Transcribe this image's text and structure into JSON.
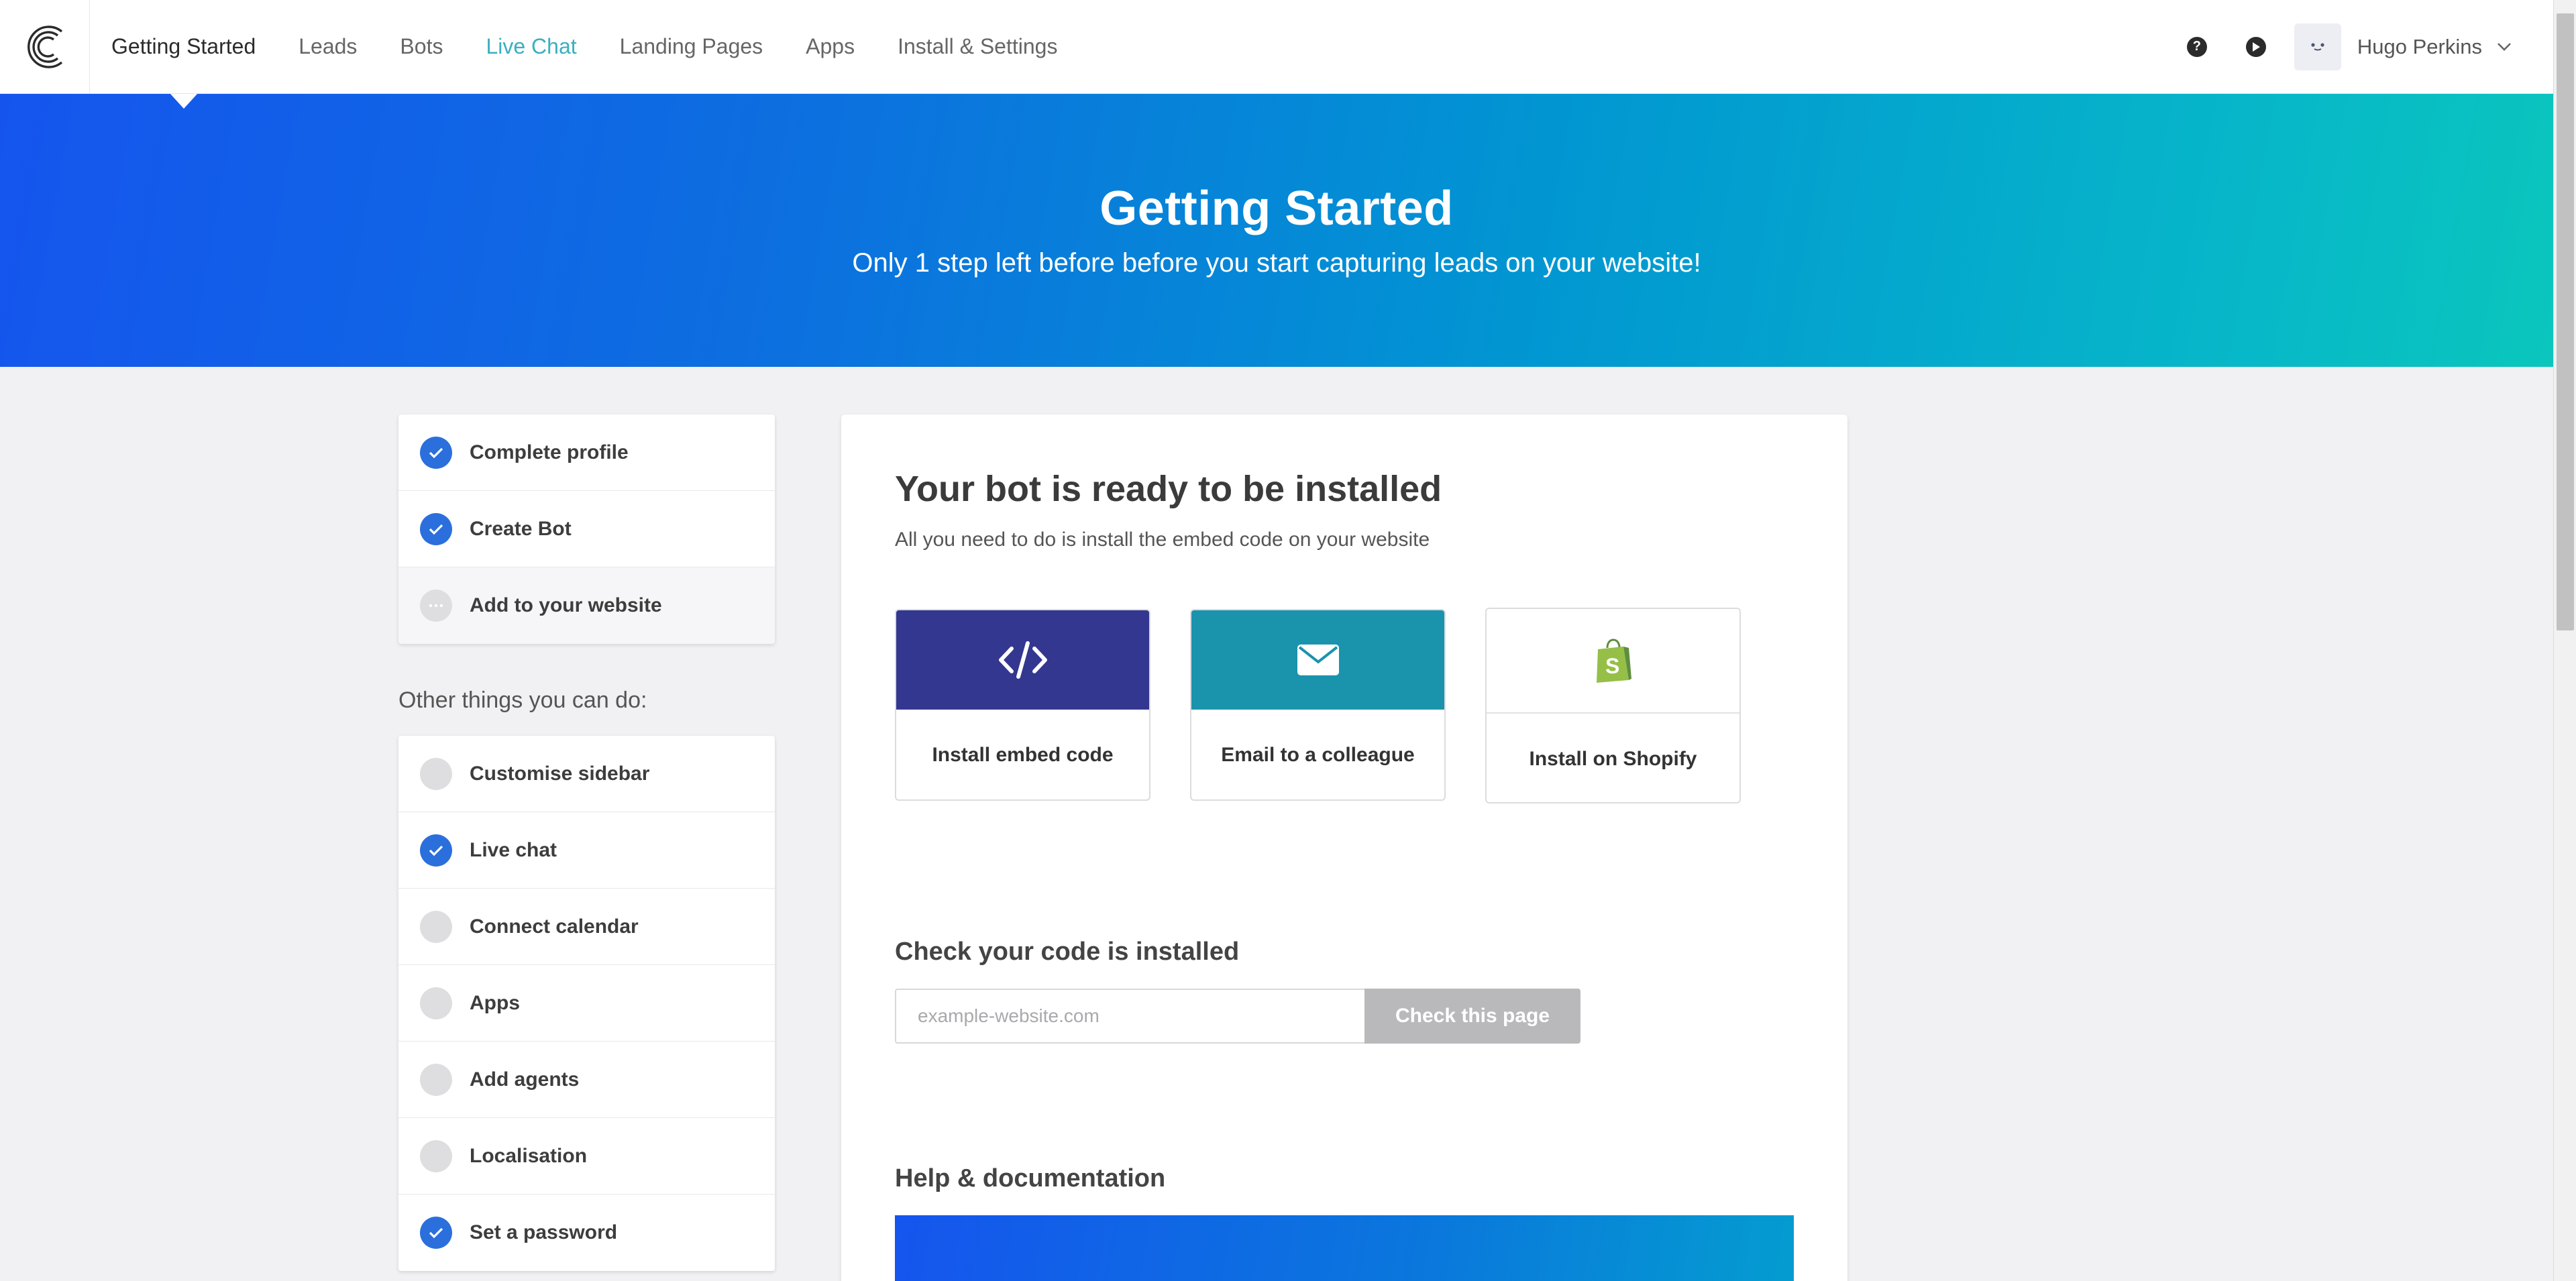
{
  "nav": {
    "items": [
      {
        "label": "Getting Started",
        "state": "active"
      },
      {
        "label": "Leads",
        "state": "normal"
      },
      {
        "label": "Bots",
        "state": "normal"
      },
      {
        "label": "Live Chat",
        "state": "highlight"
      },
      {
        "label": "Landing Pages",
        "state": "normal"
      },
      {
        "label": "Apps",
        "state": "normal"
      },
      {
        "label": "Install & Settings",
        "state": "normal"
      }
    ],
    "help_icon": "question-circle-icon",
    "video_icon": "play-circle-icon",
    "user_name": "Hugo Perkins"
  },
  "hero": {
    "title": "Getting Started",
    "subtitle": "Only 1 step left before before you start capturing leads on your website!"
  },
  "steps": [
    {
      "label": "Complete profile",
      "status": "done"
    },
    {
      "label": "Create Bot",
      "status": "done"
    },
    {
      "label": "Add to your website",
      "status": "pending"
    }
  ],
  "other": {
    "heading": "Other things you can do:",
    "items": [
      {
        "label": "Customise sidebar",
        "status": "todo"
      },
      {
        "label": "Live chat",
        "status": "done"
      },
      {
        "label": "Connect calendar",
        "status": "todo"
      },
      {
        "label": "Apps",
        "status": "todo"
      },
      {
        "label": "Add agents",
        "status": "todo"
      },
      {
        "label": "Localisation",
        "status": "todo"
      },
      {
        "label": "Set a password",
        "status": "done"
      }
    ]
  },
  "main": {
    "title": "Your bot is ready to be installed",
    "subtitle": "All you need to do is install the embed code on your website",
    "options": [
      {
        "label": "Install embed code",
        "icon": "code-icon",
        "color": "#33378f"
      },
      {
        "label": "Email to a colleague",
        "icon": "envelope-icon",
        "color": "#1a93ad"
      },
      {
        "label": "Install on Shopify",
        "icon": "shopify-bag-icon",
        "color": "#95bf47"
      }
    ],
    "check": {
      "title": "Check your code is installed",
      "placeholder": "example-website.com",
      "button": "Check this page"
    },
    "help_title": "Help & documentation"
  },
  "colors": {
    "accent": "#2b6fdc",
    "live_chat": "#3aafc0",
    "hero_start": "#1555ee",
    "hero_end": "#0ac6bd"
  }
}
